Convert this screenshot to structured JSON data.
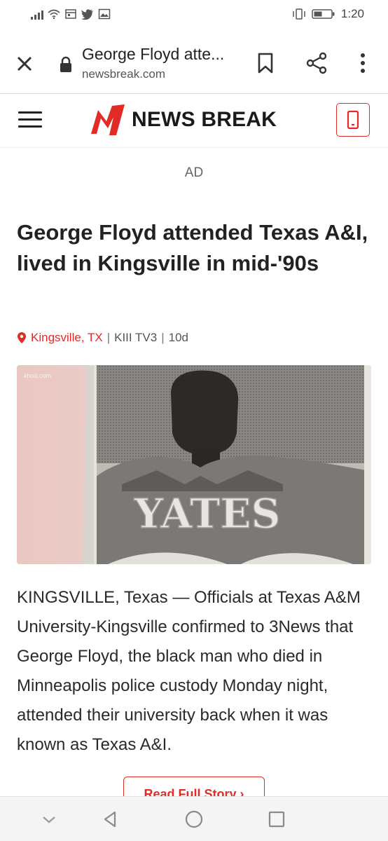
{
  "status_bar": {
    "time": "1:20",
    "icons": [
      "signal-icon",
      "wifi-icon",
      "calendar-icon",
      "twitter-icon",
      "gallery-icon",
      "vibrate-icon",
      "battery-icon"
    ]
  },
  "browser": {
    "page_title": "George Floyd atte...",
    "domain": "newsbreak.com",
    "icons": [
      "close-icon",
      "lock-icon",
      "bookmark-icon",
      "share-icon",
      "more-vert-icon"
    ]
  },
  "site_header": {
    "brand_name": "NEWS BREAK",
    "icons": [
      "menu-icon",
      "newsbreak-logo",
      "phone-app-icon"
    ],
    "brand_color": "#e02b27"
  },
  "ad_label": "AD",
  "article": {
    "headline": "George Floyd attended Texas A&I, lived in Kingsville in mid-'90s",
    "location": "Kingsville, TX",
    "source": "KIII TV3",
    "age": "10d",
    "image_credit": "khou.com",
    "jersey_text": "YATES",
    "body": "KINGSVILLE, Texas — Officials at Texas A&M University-Kingsville confirmed to 3News that George Floyd, the black man who died in Minneapolis police custody Monday night, attended their university back when it was known as Texas A&I.",
    "read_more": "Read Full Story ›"
  },
  "nav_bar": {
    "icons": [
      "chevron-down-icon",
      "back-icon",
      "home-icon",
      "recents-icon"
    ]
  }
}
